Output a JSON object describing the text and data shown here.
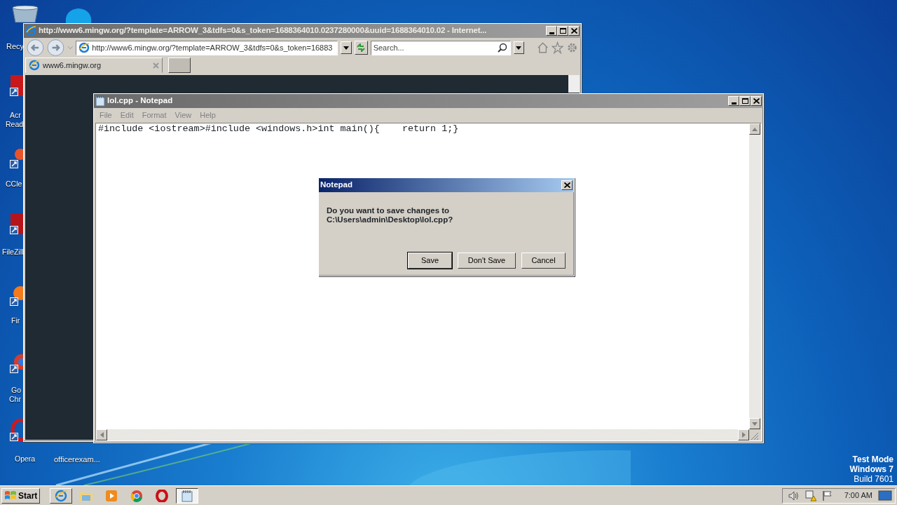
{
  "desktop_icons": [
    {
      "label_lines": [
        "Recy"
      ]
    },
    {
      "label_lines": [
        "Acr",
        "Read"
      ]
    },
    {
      "label_lines": [
        "CCle"
      ]
    },
    {
      "label_lines": [
        "FileZill"
      ]
    },
    {
      "label_lines": [
        "Fir"
      ]
    },
    {
      "label_lines": [
        "Go",
        "Chr"
      ]
    },
    {
      "label_lines": [
        "Opera"
      ]
    },
    {
      "label_lines": [
        "officerexam..."
      ]
    }
  ],
  "browser": {
    "title": "http://www6.mingw.org/?template=ARROW_3&tdfs=0&s_token=1688364010.0237280000&uuid=1688364010.02 - Internet...",
    "address": "http://www6.mingw.org/?template=ARROW_3&tdfs=0&s_token=16883",
    "search": {
      "placeholder": "Search..."
    },
    "tabs": [
      {
        "label": "www6.mingw.org",
        "selected": true
      }
    ]
  },
  "notepad": {
    "title": "lol.cpp - Notepad",
    "menu": [
      "File",
      "Edit",
      "Format",
      "View",
      "Help"
    ],
    "text": "#include <iostream>#include <windows.h>int main(){    return 1;}"
  },
  "dialog": {
    "title": "Notepad",
    "message": "Do you want to save changes to C:\\Users\\admin\\Desktop\\lol.cpp?",
    "buttons": [
      {
        "label": "Save",
        "default": true
      },
      {
        "label": "Don't Save",
        "default": false
      },
      {
        "label": "Cancel",
        "default": false
      }
    ]
  },
  "watermark_text": [
    "Test Mode",
    "Windows 7",
    "Build 7601"
  ],
  "taskbar": {
    "start": "Start",
    "apps": [
      {
        "kind": "window",
        "active": false
      },
      {
        "kind": "launcher",
        "active": false
      },
      {
        "kind": "launcher",
        "active": false
      },
      {
        "kind": "launcher",
        "active": false
      },
      {
        "kind": "launcher",
        "active": false
      },
      {
        "kind": "window",
        "active": true
      }
    ],
    "clock": "7:00 AM"
  }
}
